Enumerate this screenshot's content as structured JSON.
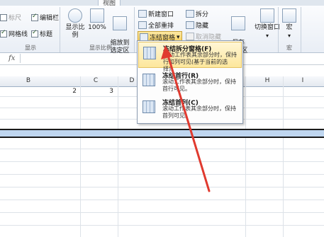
{
  "tabs": {
    "active": "视图"
  },
  "show_group": {
    "label": "显示",
    "checkboxes": [
      {
        "label": "标尺",
        "checked": false
      },
      {
        "label": "编辑栏",
        "checked": true
      },
      {
        "label": "网格线",
        "checked": true
      },
      {
        "label": "标题",
        "checked": true
      }
    ]
  },
  "zoom_group": {
    "label": "显示比例",
    "zoom_label": "显示比例",
    "zoom100_label": "100%",
    "zoom_selection_label": "缩放到\n选定区域"
  },
  "window_group": {
    "new_window": "新建窗口",
    "arrange_all": "全部重排",
    "freeze_panes": "冻结窗格",
    "split": "拆分",
    "hide": "隐藏",
    "unhide": "取消隐藏",
    "save_workspace": "保存\n工作区",
    "switch_window": "切换窗口"
  },
  "macro_group": {
    "macro_label": "宏",
    "label": "宏"
  },
  "formula_bar": {
    "fx": "fx"
  },
  "columns": [
    "B",
    "C",
    "D",
    "H",
    "I"
  ],
  "cells": [
    {
      "col": "B",
      "value": "2"
    },
    {
      "col": "C",
      "value": "3"
    }
  ],
  "freeze_menu": {
    "items": [
      {
        "title": "冻结拆分窗格(F)",
        "desc": "滚动工作表其余部分时，保持行和列可见(基于当前的选择)。",
        "highlighted": true
      },
      {
        "title": "冻结首行(R)",
        "desc": "滚动工作表其余部分时，保持首行可见。",
        "highlighted": false
      },
      {
        "title": "冻结首列(C)",
        "desc": "滚动工作表其余部分时，保持首列可见。",
        "highlighted": false
      }
    ]
  },
  "colors": {
    "highlight": "#fde79c",
    "arrow": "#e03a2f",
    "freeze_line": "#1a1a1a"
  }
}
